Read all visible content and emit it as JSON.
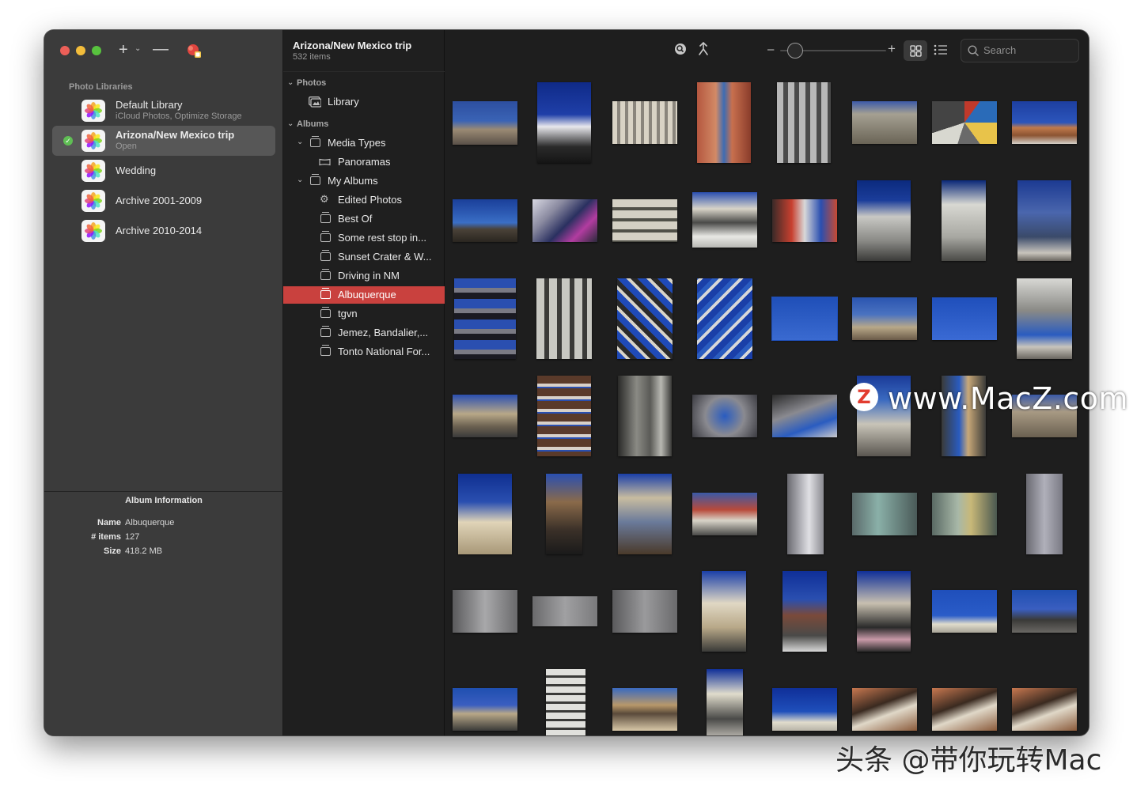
{
  "window": {
    "title": "Arizona/New Mexico trip",
    "subtitle": "532 items"
  },
  "toolbar_left": {
    "add_icon": "plus-icon",
    "remove_icon": "minus-icon",
    "photos_icon": "photos-app-icon"
  },
  "libraries": {
    "header": "Photo Libraries",
    "items": [
      {
        "name": "Default Library",
        "sub": "iCloud Photos, Optimize Storage",
        "selected": false
      },
      {
        "name": "Arizona/New Mexico trip",
        "sub": "Open",
        "selected": true
      },
      {
        "name": "Wedding",
        "sub": "",
        "selected": false
      },
      {
        "name": "Archive 2001-2009",
        "sub": "",
        "selected": false
      },
      {
        "name": "Archive 2010-2014",
        "sub": "",
        "selected": false
      }
    ]
  },
  "album_info": {
    "title": "Album Information",
    "name_label": "Name",
    "name_value": "Albuquerque",
    "items_label": "# items",
    "items_value": "127",
    "size_label": "Size",
    "size_value": "418.2 MB"
  },
  "sidebar": {
    "photos_header": "Photos",
    "library": "Library",
    "albums_header": "Albums",
    "media_types": "Media Types",
    "panoramas": "Panoramas",
    "my_albums": "My Albums",
    "albums": [
      {
        "label": "Edited Photos",
        "selected": false,
        "smart": true
      },
      {
        "label": "Best Of",
        "selected": false
      },
      {
        "label": "Some rest stop in...",
        "selected": false
      },
      {
        "label": "Sunset Crater & W...",
        "selected": false
      },
      {
        "label": "Driving in NM",
        "selected": false
      },
      {
        "label": "Albuquerque",
        "selected": true
      },
      {
        "label": "tgvn",
        "selected": false
      },
      {
        "label": "Jemez, Bandalier,...",
        "selected": false
      },
      {
        "label": "Tonto National For...",
        "selected": false
      }
    ]
  },
  "grid_toolbar": {
    "search_placeholder": "Search",
    "zoom_level": 0.1
  },
  "watermarks": {
    "macz_badge": "Z",
    "macz_text": "www.MacZ.com",
    "toutiao": "头条 @带你玩转Mac"
  },
  "colors": {
    "selection_red": "#c9413e",
    "sidebar_bg": "#3b3b3b"
  }
}
